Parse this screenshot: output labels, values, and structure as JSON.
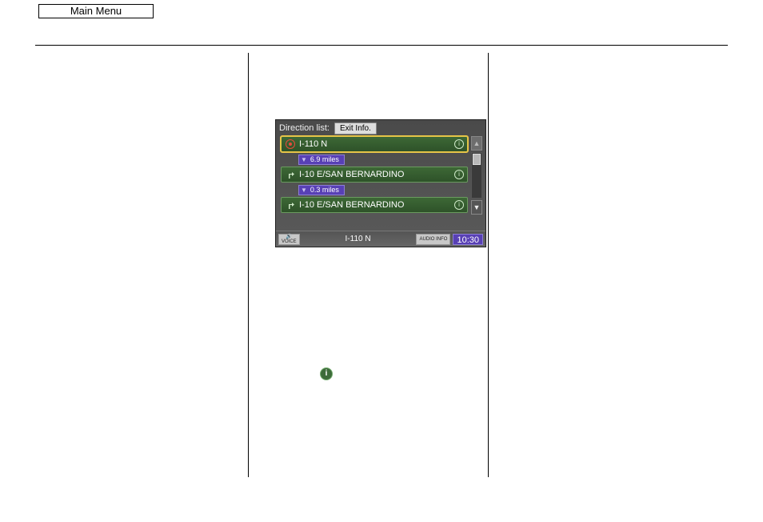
{
  "main_menu_label": "Main Menu",
  "nav": {
    "title": "Direction list:",
    "exit_info_label": "Exit Info.",
    "rows": [
      {
        "icon": "target",
        "label": "I-110 N",
        "selected": true
      },
      {
        "distance": "6.9 miles"
      },
      {
        "icon": "turn",
        "label": "I-10 E/SAN BERNARDINO",
        "selected": false
      },
      {
        "distance": "0.3 miles"
      },
      {
        "icon": "turn",
        "label": "I-10 E/SAN BERNARDINO",
        "selected": false
      }
    ],
    "footer": {
      "voice_label": "VOICE",
      "route_label": "I-110 N",
      "audio_label": "AUDIO INFO",
      "clock": "10:30"
    }
  },
  "inline_info_glyph": "i"
}
